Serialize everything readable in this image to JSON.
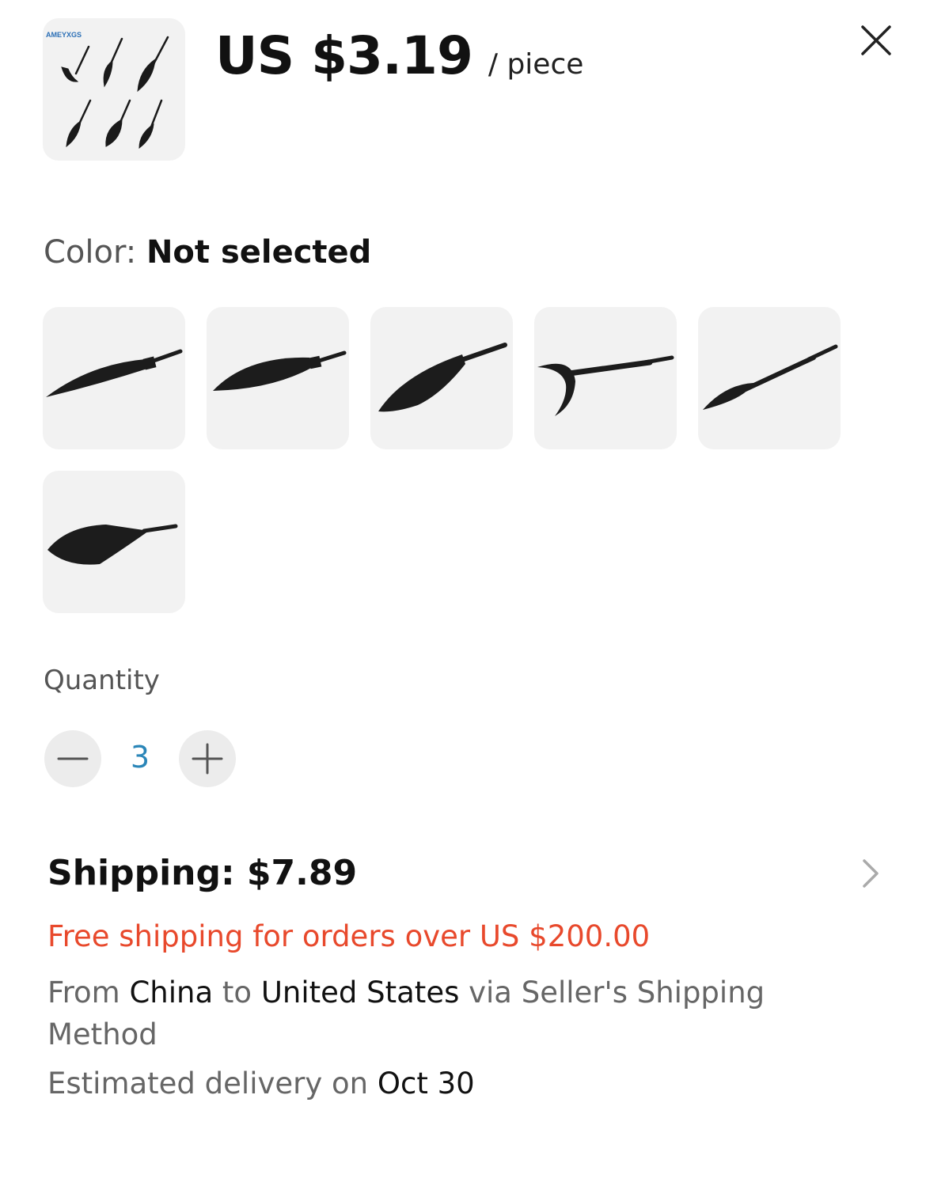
{
  "product": {
    "thumbnail_icon": "arrowhead-set-thumbnail",
    "brand_watermark": "AMEYXGS",
    "price": "US $3.19",
    "price_unit": "/ piece"
  },
  "color": {
    "label": "Color:",
    "value": "Not selected",
    "swatches": [
      {
        "icon": "blade-arrowhead-1"
      },
      {
        "icon": "blade-arrowhead-2"
      },
      {
        "icon": "blade-arrowhead-3"
      },
      {
        "icon": "crescent-arrowhead"
      },
      {
        "icon": "spear-arrowhead"
      },
      {
        "icon": "broad-arrowhead"
      }
    ]
  },
  "quantity": {
    "label": "Quantity",
    "value": "3",
    "minus_icon": "minus-icon",
    "plus_icon": "plus-icon"
  },
  "shipping": {
    "title": "Shipping: $7.89",
    "free_shipping": "Free shipping for orders over US $200.00",
    "from_prefix": "From ",
    "origin": "China",
    "to_word": " to ",
    "destination": "United States",
    "method_text": " via Seller's Shipping Method",
    "eta_prefix": "Estimated delivery on ",
    "eta_date": "Oct 30"
  },
  "colors": {
    "accent_red": "#e8492c",
    "quantity_blue": "#2a86b8",
    "tile_bg": "#f2f2f2"
  }
}
